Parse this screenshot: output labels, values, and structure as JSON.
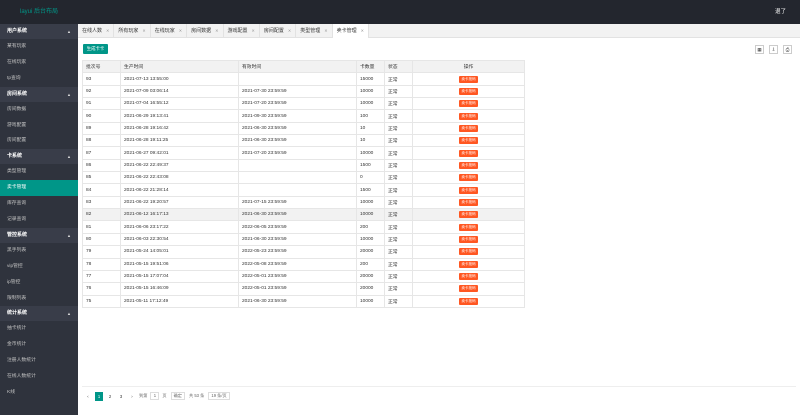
{
  "app": {
    "logo": "layui 后台布局",
    "logout": "退了"
  },
  "sidebar": {
    "sections": [
      {
        "title": "用户系统",
        "items": [
          "某有玩家",
          "在线玩家",
          "tp查询"
        ]
      },
      {
        "title": "房间系统",
        "items": [
          "房间数据",
          "游戏配置",
          "房间配置"
        ]
      },
      {
        "title": "卡系统",
        "items": [
          "类型管理",
          "卖卡管理",
          "库存查询",
          "记录查询"
        ]
      },
      {
        "title": "管控系统",
        "items": [
          "黑手列表",
          "vip管控",
          "ip管控",
          "限制列表"
        ]
      },
      {
        "title": "统计系统",
        "items": [
          "抽卡统计",
          "金币统计",
          "注册人数统计",
          "在线人数统计",
          "K线"
        ]
      }
    ],
    "active_item": "卖卡管理"
  },
  "tabs": [
    "在线人数",
    "所有玩家",
    "在线玩家",
    "房间数据",
    "游戏配置",
    "房间配置",
    "类型管理",
    "卖卡管理"
  ],
  "active_tab": "卖卡管理",
  "toolbar": {
    "generate_label": "生成卡卡"
  },
  "table": {
    "columns": [
      "批次号",
      "生产时间",
      "有效时间",
      "卡数量",
      "状态",
      "操作"
    ],
    "action_label": "卖卡批码",
    "rows": [
      [
        "93",
        "2021-07-13 13:55:00",
        "",
        "15000",
        "正常"
      ],
      [
        "92",
        "2021-07-09 03:06:14",
        "2021-07-30 23:59:59",
        "10000",
        "正常"
      ],
      [
        "91",
        "2021-07-04 16:55:12",
        "2021-07-20 23:59:59",
        "10000",
        "正常"
      ],
      [
        "90",
        "2021-06-29 19:13:41",
        "2021-09-30 23:59:59",
        "100",
        "正常"
      ],
      [
        "89",
        "2021-06-28 19:16:42",
        "2021-06-30 23:59:59",
        "10",
        "正常"
      ],
      [
        "88",
        "2021-06-28 19:11:25",
        "2021-06-30 23:59:59",
        "10",
        "正常"
      ],
      [
        "87",
        "2021-06-27 09:42:01",
        "2021-07-20 23:59:59",
        "10000",
        "正常"
      ],
      [
        "86",
        "2021-06-22 22:49:37",
        "",
        "1500",
        "正常"
      ],
      [
        "85",
        "2021-06-22 22:43:08",
        "",
        "0",
        "正常"
      ],
      [
        "84",
        "2021-06-22 21:28:14",
        "",
        "1500",
        "正常"
      ],
      [
        "83",
        "2021-06-22 19:20:57",
        "2021-07-15 23:59:59",
        "10000",
        "正常"
      ],
      [
        "82",
        "2021-06-12 16:17:13",
        "2021-06-30 23:59:59",
        "10000",
        "正常"
      ],
      [
        "81",
        "2021-06-06 23:17:22",
        "2022-06-05 23:59:59",
        "200",
        "正常"
      ],
      [
        "80",
        "2021-06-03 22:30:54",
        "2021-06-30 23:59:59",
        "10000",
        "正常"
      ],
      [
        "79",
        "2021-05-24 14:05:01",
        "2022-05-23 23:59:59",
        "20000",
        "正常"
      ],
      [
        "78",
        "2021-05-15 19:51:06",
        "2022-05-08 23:59:59",
        "200",
        "正常"
      ],
      [
        "77",
        "2021-05-15 17:07:04",
        "2022-05-01 23:59:59",
        "20000",
        "正常"
      ],
      [
        "76",
        "2021-05-15 16:46:09",
        "2022-05-01 23:59:59",
        "20000",
        "正常"
      ],
      [
        "75",
        "2021-05-11 17:12:49",
        "2021-06-30 23:59:59",
        "10000",
        "正常"
      ]
    ],
    "highlighted_row": 11
  },
  "pager": {
    "prev": "‹",
    "pages": [
      "1",
      "2",
      "3"
    ],
    "next": "›",
    "goto_label": "到第",
    "page_value": "1",
    "page_suffix": "页",
    "confirm": "确定",
    "total": "共 53 条",
    "page_size": "19 条/页"
  }
}
